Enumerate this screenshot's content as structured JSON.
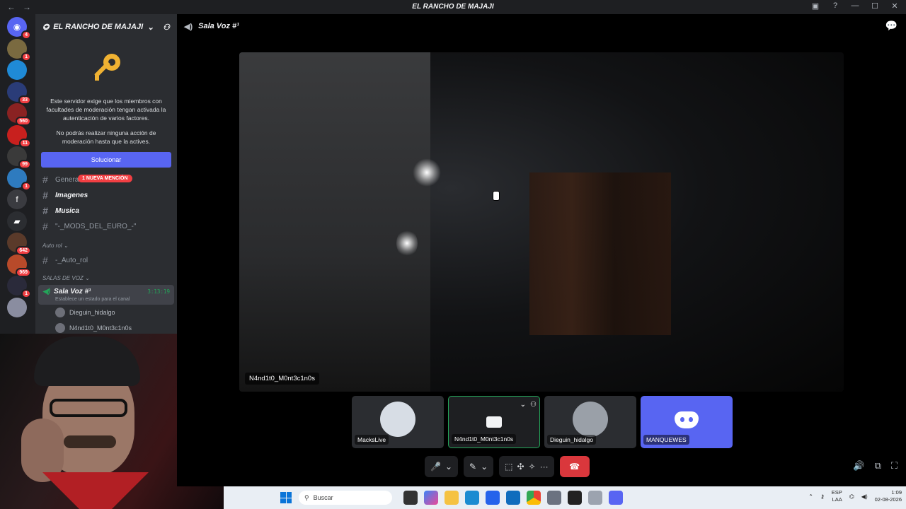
{
  "window": {
    "title": "EL RANCHO DE MAJAJI",
    "nav_back": "←",
    "nav_fwd": "→",
    "inbox_icon": "▣",
    "help_icon": "?",
    "min": "—",
    "max": "☐",
    "close": "✕"
  },
  "guilds": [
    {
      "badge": "4",
      "color": "#5865f2",
      "glyph": "◉"
    },
    {
      "badge": "1",
      "color": "#7a6a40",
      "glyph": ""
    },
    {
      "badge": "",
      "color": "#1f8ad6",
      "glyph": ""
    },
    {
      "badge": "33",
      "color": "#2a3c78",
      "glyph": ""
    },
    {
      "badge": "560",
      "color": "#8a2222",
      "glyph": ""
    },
    {
      "badge": "11",
      "color": "#c8201e",
      "glyph": ""
    },
    {
      "badge": "99",
      "color": "#3a3a3a",
      "glyph": ""
    },
    {
      "badge": "1",
      "color": "#2e7bbf",
      "glyph": ""
    },
    {
      "badge": "",
      "color": "#3a3b40",
      "glyph": "f"
    },
    {
      "badge": "",
      "color": "#2b2d31",
      "glyph": "▰"
    },
    {
      "badge": "642",
      "color": "#5a3a2a",
      "glyph": ""
    },
    {
      "badge": "969",
      "color": "#b84a2a",
      "glyph": ""
    },
    {
      "badge": "1",
      "color": "#2a2a3a",
      "glyph": ""
    },
    {
      "badge": "",
      "color": "#8a8da0",
      "glyph": ""
    }
  ],
  "server": {
    "name": "EL RANCHO DE MAJAJI",
    "mfa_text_1": "Este servidor exige que los miembros con facultades de moderación tengan activada la autenticación de varios factores.",
    "mfa_text_2": "No podrás realizar ninguna acción de moderación hasta que la actives.",
    "fix_button": "Solucionar",
    "mention_badge": "1 NUEVA MENCIÓN"
  },
  "channels": [
    {
      "label": "General",
      "style": "dim"
    },
    {
      "label": "Imagenes",
      "style": "bold"
    },
    {
      "label": "Musica",
      "style": "bold"
    },
    {
      "label": "\"-_MODS_DEL_EURO_-\"",
      "style": "dim"
    }
  ],
  "categories": {
    "auto_rol": "Auto rol",
    "auto_rol_channel": "-_Auto_rol",
    "voice": "SALAS DE VOZ"
  },
  "voice_channel": {
    "name": "Sala Voz #¹",
    "time": "3:13:19",
    "status": "Establece un estado para el canal",
    "users": [
      "Dieguin_hidalgo",
      "N4nd1t0_M0nt3c1n0s"
    ]
  },
  "main": {
    "channel_title": "Sala Voz #¹",
    "stream_name": "N4nd1t0_M0nt3c1n0s"
  },
  "participants": [
    {
      "name": "MacksLive",
      "kind": "avatar"
    },
    {
      "name": "N4nd1t0_M0nt3c1n0s",
      "kind": "camera",
      "speaking": true
    },
    {
      "name": "Dieguin_hidalgo",
      "kind": "avatar"
    },
    {
      "name": "MANQUEWES",
      "kind": "discord"
    }
  ],
  "controls": {
    "mic": "🎤",
    "camera": "✎",
    "share": "⬚",
    "activity": "✣",
    "soundboard": "✧",
    "more": "···",
    "leave": "☎"
  },
  "taskbar": {
    "search_placeholder": "Buscar",
    "lang_1": "ESP",
    "lang_2": "LAA",
    "time": "1:09",
    "date": "02-08-2026"
  },
  "colors": {
    "brand": "#5865f2",
    "danger": "#da373c",
    "speaking": "#23a559"
  }
}
